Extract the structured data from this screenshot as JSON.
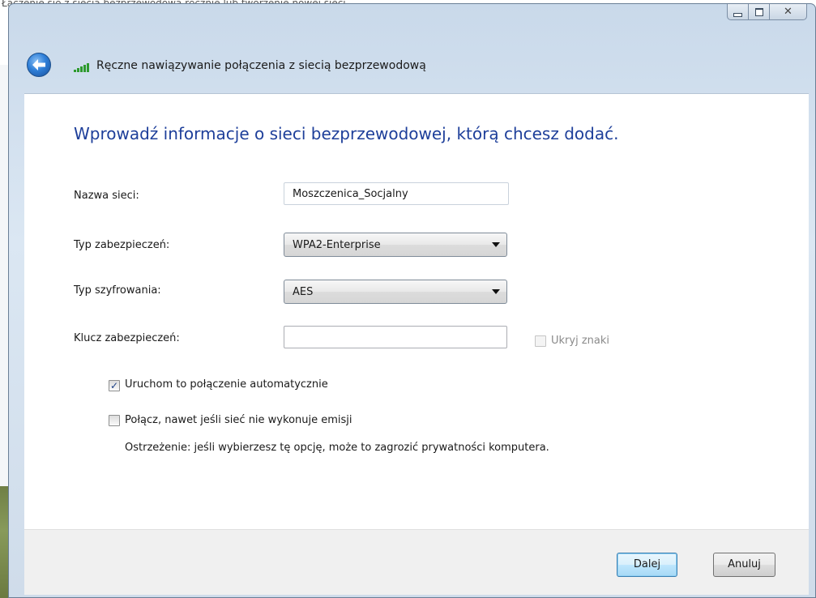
{
  "background": {
    "top_text": "Łączenie się z siecią bezprzewodową ręcznie lub tworzenie nowej sieci"
  },
  "window": {
    "title": "Ręczne nawiązywanie połączenia z siecią bezprzewodową",
    "close_glyph": "✕"
  },
  "main": {
    "heading": "Wprowadź informacje o sieci bezprzewodowej, którą chcesz dodać.",
    "network_name": {
      "label": "Nazwa sieci:",
      "value": "Moszczenica_Socjalny"
    },
    "security_type": {
      "label": "Typ zabezpieczeń:",
      "value": "WPA2-Enterprise"
    },
    "encryption_type": {
      "label": "Typ szyfrowania:",
      "value": "AES"
    },
    "security_key": {
      "label": "Klucz zabezpieczeń:",
      "value": ""
    },
    "hide_chars": {
      "label": "Ukryj znaki",
      "checked": false
    },
    "auto_connect": {
      "label": "Uruchom to połączenie automatycznie",
      "checked": true
    },
    "connect_hidden": {
      "label": "Połącz, nawet jeśli sieć nie wykonuje emisji",
      "checked": false
    },
    "warning": "Ostrzeżenie: jeśli wybierzesz tę opcję, może to zagrozić prywatności komputera."
  },
  "footer": {
    "next_label": "Dalej",
    "cancel_label": "Anuluj"
  },
  "colors": {
    "heading": "#1e3f9a",
    "accent": "#2f7fd8"
  }
}
